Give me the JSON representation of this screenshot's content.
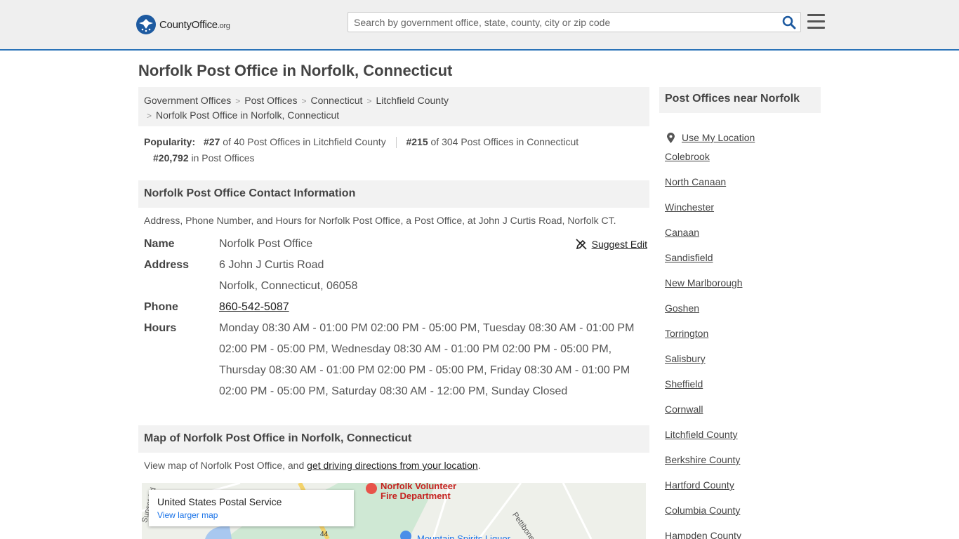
{
  "header": {
    "logo_main": "County",
    "logo_bold": "Office",
    "logo_tld": ".org",
    "search_placeholder": "Search by government office, state, county, city or zip code"
  },
  "page_title": "Norfolk Post Office in Norfolk, Connecticut",
  "breadcrumb": {
    "items": [
      "Government Offices",
      "Post Offices",
      "Connecticut",
      "Litchfield County"
    ],
    "current": "Norfolk Post Office in Norfolk, Connecticut"
  },
  "popularity": {
    "label": "Popularity:",
    "rank1": "#27",
    "rank1_text": "of 40 Post Offices in Litchfield County",
    "rank2": "#215",
    "rank2_text": "of 304 Post Offices in Connecticut",
    "rank3": "#20,792",
    "rank3_text": "in Post Offices"
  },
  "contact": {
    "heading": "Norfolk Post Office Contact Information",
    "description": "Address, Phone Number, and Hours for Norfolk Post Office, a Post Office, at John J Curtis Road, Norfolk CT.",
    "suggest_edit": "Suggest Edit",
    "name_label": "Name",
    "name_value": "Norfolk Post Office",
    "address_label": "Address",
    "address_line1": "6 John J Curtis Road",
    "address_line2": "Norfolk, Connecticut, 06058",
    "phone_label": "Phone",
    "phone_value": "860-542-5087",
    "hours_label": "Hours",
    "hours_value": "Monday 08:30 AM - 01:00 PM 02:00 PM - 05:00 PM, Tuesday 08:30 AM - 01:00 PM 02:00 PM - 05:00 PM, Wednesday 08:30 AM - 01:00 PM 02:00 PM - 05:00 PM, Thursday 08:30 AM - 01:00 PM 02:00 PM - 05:00 PM, Friday 08:30 AM - 01:00 PM 02:00 PM - 05:00 PM, Saturday 08:30 AM - 12:00 PM, Sunday Closed"
  },
  "map_section": {
    "heading": "Map of Norfolk Post Office in Norfolk, Connecticut",
    "desc_prefix": "View map of Norfolk Post Office, and ",
    "desc_link": "get driving directions from your location",
    "desc_suffix": ".",
    "card_title": "United States Postal Service",
    "card_link": "View larger map",
    "label_fire": "Norfolk Volunteer",
    "label_fire2": "Fire Department",
    "label_road": "Pettibone Ln",
    "label_liquor": "Mountain Spirits Liquor",
    "label_sunset": "Sunset Rd",
    "label_route": "44"
  },
  "sidebar": {
    "heading": "Post Offices near Norfolk",
    "use_location": "Use My Location",
    "items": [
      "Colebrook",
      "North Canaan",
      "Winchester",
      "Canaan",
      "Sandisfield",
      "New Marlborough",
      "Goshen",
      "Torrington",
      "Salisbury",
      "Sheffield",
      "Cornwall",
      "Litchfield County",
      "Berkshire County",
      "Hartford County",
      "Columbia County",
      "Hampden County"
    ]
  },
  "colors": {
    "header_bg": "#efefef",
    "accent_blue": "#2b73b8",
    "panel_bg": "#f2f2f2",
    "map_link": "#1a73e8"
  }
}
